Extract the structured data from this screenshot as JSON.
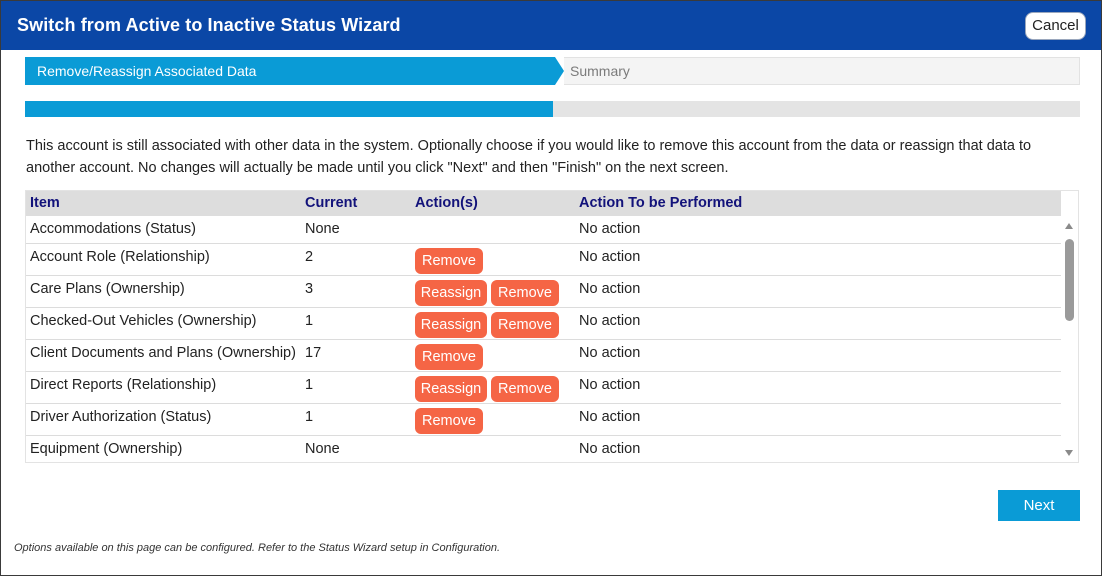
{
  "window": {
    "title": "Switch from Active to Inactive Status Wizard",
    "cancel_label": "Cancel"
  },
  "stepper": {
    "active": "Remove/Reassign Associated Data",
    "next": "Summary"
  },
  "progress": {
    "fraction": 0.5
  },
  "intro": "This account is still associated with other data in the system. Optionally choose if you would like to remove this account from the data or reassign that data to another account. No changes will actually be made until you click \"Next\" and then \"Finish\" on the next screen.",
  "table": {
    "headers": {
      "item": "Item",
      "current": "Current",
      "actions": "Action(s)",
      "performed": "Action To be Performed"
    },
    "rows": [
      {
        "item": "Accommodations (Status)",
        "current": "None",
        "actions": [],
        "performed": "No action"
      },
      {
        "item": "Account Role (Relationship)",
        "current": "2",
        "actions": [
          "Remove"
        ],
        "performed": "No action"
      },
      {
        "item": "Care Plans (Ownership)",
        "current": "3",
        "actions": [
          "Reassign",
          "Remove"
        ],
        "performed": "No action"
      },
      {
        "item": "Checked-Out Vehicles (Ownership)",
        "current": "1",
        "actions": [
          "Reassign",
          "Remove"
        ],
        "performed": "No action"
      },
      {
        "item": "Client Documents and Plans (Ownership)",
        "current": "17",
        "actions": [
          "Remove"
        ],
        "performed": "No action"
      },
      {
        "item": "Direct Reports (Relationship)",
        "current": "1",
        "actions": [
          "Reassign",
          "Remove"
        ],
        "performed": "No action"
      },
      {
        "item": "Driver Authorization (Status)",
        "current": "1",
        "actions": [
          "Remove"
        ],
        "performed": "No action"
      },
      {
        "item": "Equipment (Ownership)",
        "current": "None",
        "actions": [],
        "performed": "No action"
      }
    ]
  },
  "next_label": "Next",
  "footnote": "Options available on this page can be configured. Refer to the Status Wizard setup in Configuration.",
  "colors": {
    "titlebar": "#0b47a6",
    "accent": "#0a9bd6",
    "action_button": "#f56545",
    "header_text": "#12127a"
  }
}
